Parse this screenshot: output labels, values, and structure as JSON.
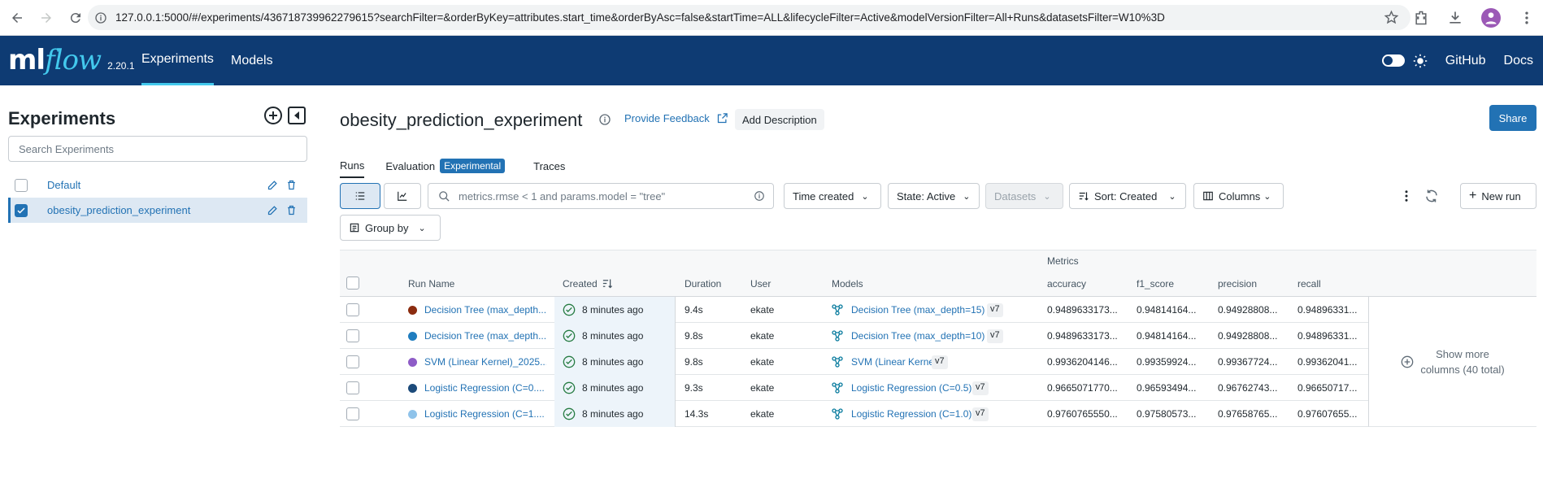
{
  "browser": {
    "url": "127.0.0.1:5000/#/experiments/436718739962279615?searchFilter=&orderByKey=attributes.start_time&orderByAsc=false&startTime=ALL&lifecycleFilter=Active&modelVersionFilter=All+Runs&datasetsFilter=W10%3D"
  },
  "header": {
    "logo_ml": "ml",
    "logo_flow": "flow",
    "version": "2.20.1",
    "tabs": [
      {
        "label": "Experiments"
      },
      {
        "label": "Models"
      }
    ],
    "github": "GitHub",
    "docs": "Docs"
  },
  "sidebar": {
    "title": "Experiments",
    "search_placeholder": "Search Experiments",
    "experiments": [
      {
        "name": "Default",
        "checked": false
      },
      {
        "name": "obesity_prediction_experiment",
        "checked": true
      }
    ]
  },
  "main": {
    "title": "obesity_prediction_experiment",
    "feedback": "Provide Feedback",
    "add_description": "Add Description",
    "share": "Share",
    "tabs": {
      "runs": "Runs",
      "evaluation": "Evaluation",
      "experimental": "Experimental",
      "traces": "Traces"
    },
    "search_placeholder": "metrics.rmse < 1 and params.model = \"tree\"",
    "filters": {
      "time": "Time created",
      "state": "State: Active",
      "datasets": "Datasets",
      "sort": "Sort: Created",
      "columns": "Columns",
      "new_run": "New run",
      "group_by": "Group by"
    }
  },
  "table": {
    "metrics_group": "Metrics",
    "columns": [
      "Run Name",
      "Created",
      "Duration",
      "User",
      "Models",
      "accuracy",
      "f1_score",
      "precision",
      "recall"
    ],
    "rows": [
      {
        "name": "Decision Tree (max_depth...",
        "color": "#8b2c0f",
        "created": "8 minutes ago",
        "duration": "9.4s",
        "user": "ekate",
        "model": "Decision Tree (max_depth=15)",
        "version": "v7",
        "accuracy": "0.9489633173...",
        "f1": "0.94814164...",
        "precision": "0.94928808...",
        "recall": "0.94896331..."
      },
      {
        "name": "Decision Tree (max_depth...",
        "color": "#1f7dbf",
        "created": "8 minutes ago",
        "duration": "9.8s",
        "user": "ekate",
        "model": "Decision Tree (max_depth=10)",
        "version": "v7",
        "accuracy": "0.9489633173...",
        "f1": "0.94814164...",
        "precision": "0.94928808...",
        "recall": "0.94896331..."
      },
      {
        "name": "SVM (Linear Kernel)_2025...",
        "color": "#8e5cc7",
        "created": "8 minutes ago",
        "duration": "9.8s",
        "user": "ekate",
        "model": "SVM (Linear Kernel)",
        "version": "v7",
        "accuracy": "0.9936204146...",
        "f1": "0.99359924...",
        "precision": "0.99367724...",
        "recall": "0.99362041..."
      },
      {
        "name": "Logistic Regression (C=0....",
        "color": "#1c4a7a",
        "created": "8 minutes ago",
        "duration": "9.3s",
        "user": "ekate",
        "model": "Logistic Regression (C=0.5)",
        "version": "v7",
        "accuracy": "0.9665071770...",
        "f1": "0.96593494...",
        "precision": "0.96762743...",
        "recall": "0.96650717..."
      },
      {
        "name": "Logistic Regression (C=1....",
        "color": "#8fc3ea",
        "created": "8 minutes ago",
        "duration": "14.3s",
        "user": "ekate",
        "model": "Logistic Regression (C=1.0)",
        "version": "v7",
        "accuracy": "0.9760765550...",
        "f1": "0.97580573...",
        "precision": "0.97658765...",
        "recall": "0.97607655..."
      }
    ],
    "show_more_1": "Show more",
    "show_more_2": "columns (40 total)"
  }
}
